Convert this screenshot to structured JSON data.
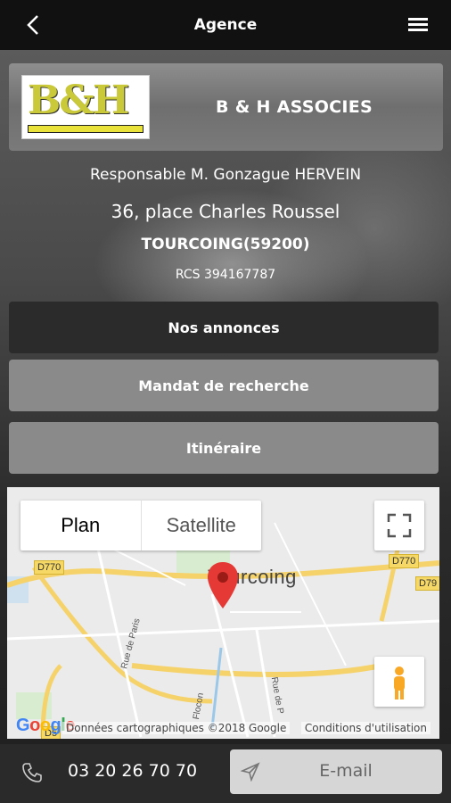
{
  "header": {
    "title": "Agence"
  },
  "agency": {
    "name": "B & H ASSOCIES",
    "logo_text": "B&H",
    "responsible": "Responsable M. Gonzague HERVEIN",
    "address": "36, place Charles Roussel",
    "city": "TOURCOING(59200)",
    "rcs": "RCS 394167787"
  },
  "actions": {
    "annonces_label": "Nos annonces",
    "mandat_label": "Mandat de recherche",
    "itineraire_label": "Itinéraire"
  },
  "map": {
    "tab_plan": "Plan",
    "tab_satellite": "Satellite",
    "active_tab": "Plan",
    "city_label": "Tourcoing",
    "road_labels": [
      "D770",
      "D770",
      "D79",
      "D5"
    ],
    "street_labels": [
      "Rue de Paris",
      "Flocon",
      "Rue de P"
    ],
    "google_logo": "Google",
    "attribution": "Données cartographiques ©2018 Google",
    "terms": "Conditions d'utilisation",
    "marker_color": "#e53935"
  },
  "contact": {
    "phone": "03 20 26 70 70",
    "email_label": "E-mail"
  }
}
